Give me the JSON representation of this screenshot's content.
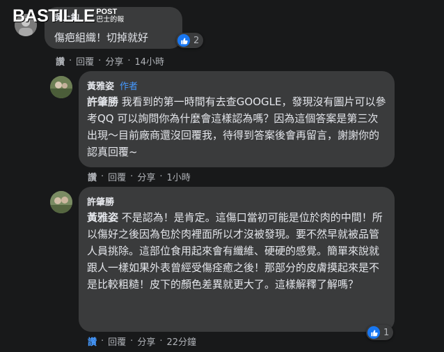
{
  "watermark": {
    "main": "BASTILLE",
    "post": "POST",
    "sub": "巴士的報"
  },
  "comments": [
    {
      "name": "吳上鈞",
      "text": "傷疤組織！切掉就好",
      "reaction_count": "2",
      "actions": {
        "like": "讚",
        "reply": "回覆",
        "share": "分享",
        "time": "14小時"
      }
    },
    {
      "name": "黃雅姿",
      "badge": "作者",
      "mention": "許肇勝",
      "text": " 我看到的第一時間有去查GOOGLE，發現沒有圖片可以參考QQ 可以詢問你為什麼會這樣認為嗎？因為這個答案是第三次出現～目前廠商還沒回覆我，待得到答案後會再留言，謝謝你的認真回覆~",
      "actions": {
        "like": "讚",
        "reply": "回覆",
        "share": "分享",
        "time": "1小時"
      }
    },
    {
      "name": "許肇勝",
      "mention": "黃雅姿",
      "text": " 不是認為！是肯定。這傷口當初可能是位於肉的中間！所以傷好之後因為包於肉裡面所以才沒被發現。要不然早就被品管人員挑除。這部位食用起來會有纖維、硬硬的感覺。簡單來說就跟人一樣如果外表曾經受傷痊癒之後！那部分的皮膚摸起來是不是比較粗糙！皮下的顏色差異就更大了。這樣解釋了解嗎？",
      "reaction_count": "1",
      "actions": {
        "like": "讚",
        "reply": "回覆",
        "share": "分享",
        "time": "22分鐘"
      }
    }
  ],
  "colors": {
    "background": "#18191a",
    "bubble": "#3a3b3c",
    "text": "#e4e6eb",
    "muted": "#b0b3b8",
    "accent": "#4599ff",
    "like_blue": "#1877f2"
  }
}
